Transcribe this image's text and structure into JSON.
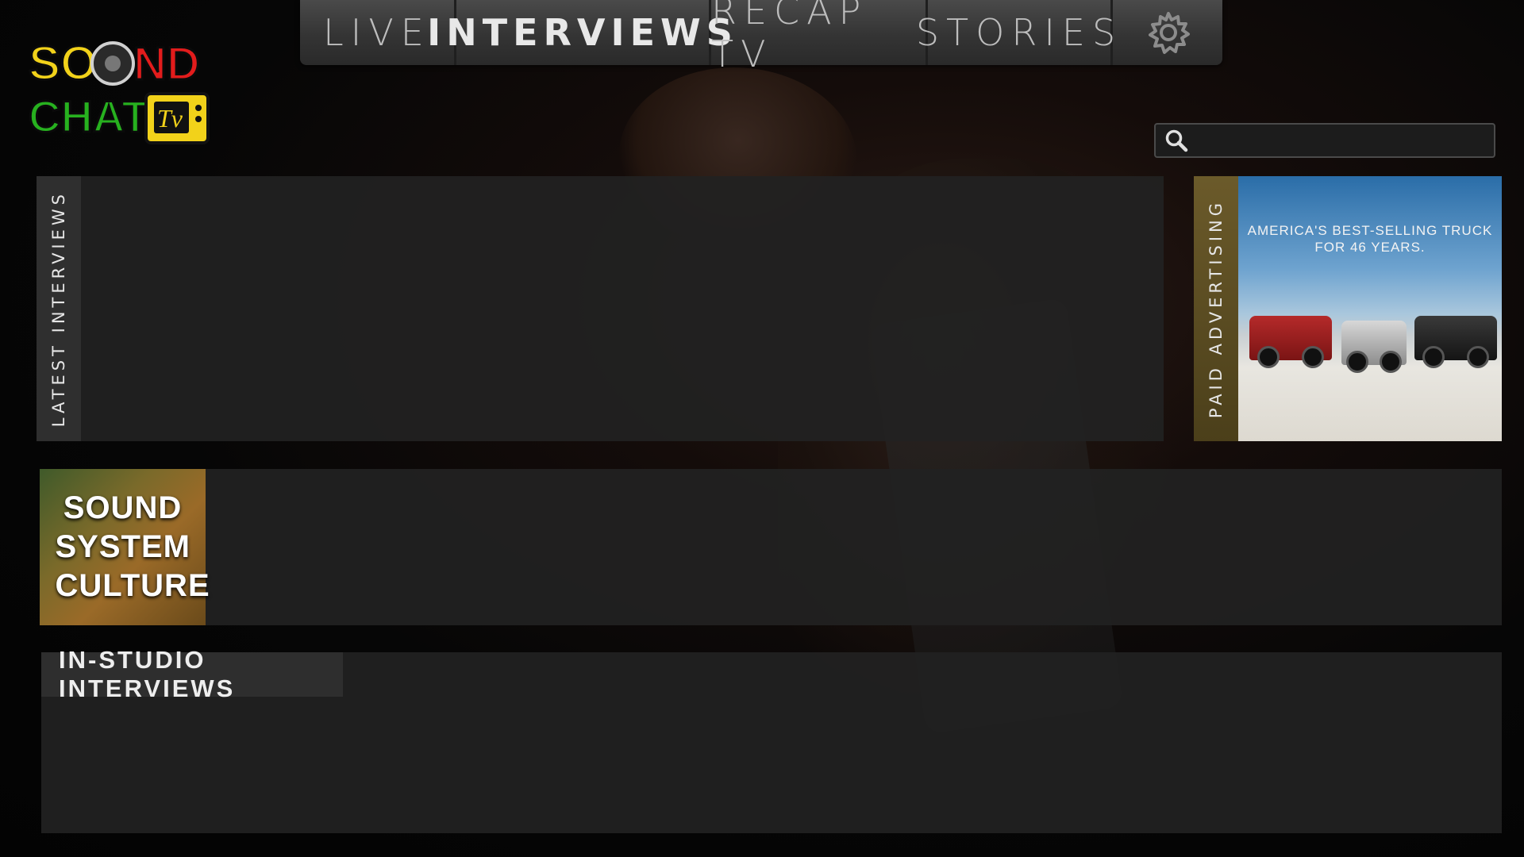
{
  "app": {
    "name": "SOUND CHAT TV"
  },
  "logo": {
    "line1": "SOUND",
    "line2": "CHAT",
    "tv": "Tv"
  },
  "nav": {
    "tabs": [
      {
        "label": "LIVE",
        "active": false
      },
      {
        "label": "INTERVIEWS",
        "active": true
      },
      {
        "label": "RECAP TV",
        "active": false
      },
      {
        "label": "STORIES",
        "active": false
      }
    ],
    "settings_icon": "gear-icon"
  },
  "search": {
    "placeholder": "",
    "value": "",
    "icon": "search-icon"
  },
  "sections": {
    "latest": {
      "label": "LATEST INTERVIEWS"
    },
    "ad": {
      "label": "PAID ADVERTISING",
      "headline": "AMERICA'S BEST-SELLING TRUCK FOR 46 YEARS."
    },
    "sound_system": {
      "title": "SOUND SYSTEM CULTURE"
    },
    "studio": {
      "label": "IN-STUDIO INTERVIEWS"
    }
  },
  "colors": {
    "nav_bg": "#3a3a3a",
    "panel_bg": "#222222",
    "ad_stripe": "#5b4c22"
  }
}
